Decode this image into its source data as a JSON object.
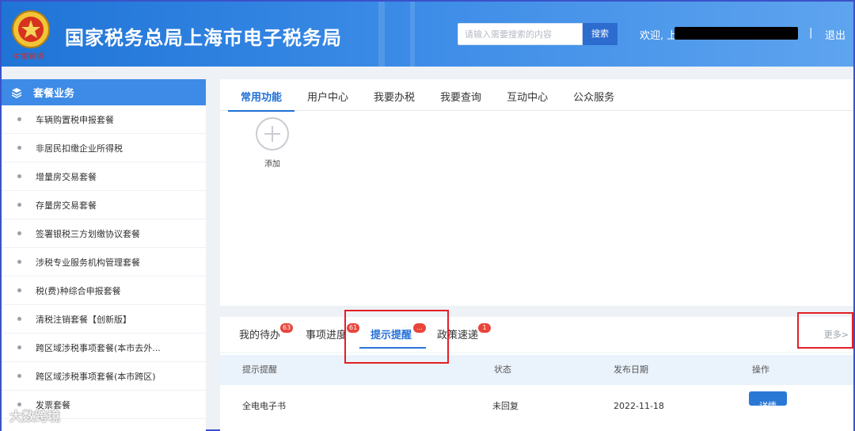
{
  "header": {
    "title": "国家税务总局上海市电子税务局",
    "emblem_script": "中国税务",
    "search_placeholder": "请输入需要搜索的内容",
    "search_button": "搜索",
    "welcome": "欢迎,",
    "user_initial": "上",
    "separator": "|",
    "logout": "退出"
  },
  "sidebar": {
    "heading": "套餐业务",
    "items": [
      {
        "label": "车辆购置税申报套餐"
      },
      {
        "label": "非居民扣缴企业所得税"
      },
      {
        "label": "增量房交易套餐"
      },
      {
        "label": "存量房交易套餐"
      },
      {
        "label": "签署银税三方划缴协议套餐"
      },
      {
        "label": "涉税专业服务机构管理套餐"
      },
      {
        "label": "税(费)种综合申报套餐"
      },
      {
        "label": "清税注销套餐【创新版】"
      },
      {
        "label": "跨区域涉税事项套餐(本市去外..."
      },
      {
        "label": "跨区域涉税事项套餐(本市跨区)"
      },
      {
        "label": "发票套餐"
      }
    ]
  },
  "main_tabs": [
    {
      "label": "常用功能",
      "active": true
    },
    {
      "label": "用户中心",
      "active": false
    },
    {
      "label": "我要办税",
      "active": false
    },
    {
      "label": "我要查询",
      "active": false
    },
    {
      "label": "互动中心",
      "active": false
    },
    {
      "label": "公众服务",
      "active": false
    }
  ],
  "add_tile": {
    "label": "添加"
  },
  "sub_tabs": [
    {
      "label": "我的待办",
      "badge": "63"
    },
    {
      "label": "事项进度",
      "badge": "61"
    },
    {
      "label": "提示提醒",
      "badge": "...",
      "active": true
    },
    {
      "label": "政策速递",
      "badge": "1"
    }
  ],
  "more_link": "更多>",
  "table": {
    "headers": [
      "提示提醒",
      "状态",
      "发布日期",
      "操作"
    ],
    "rows": [
      {
        "name": "全电电子书",
        "status": "未回复",
        "date": "2022-11-18",
        "action": "详情"
      }
    ]
  },
  "watermark": "大数跨境",
  "colors": {
    "header_start": "#1f74d6",
    "accent": "#2a73d9",
    "badge": "#e8453c",
    "annotation": "#e21f26"
  }
}
